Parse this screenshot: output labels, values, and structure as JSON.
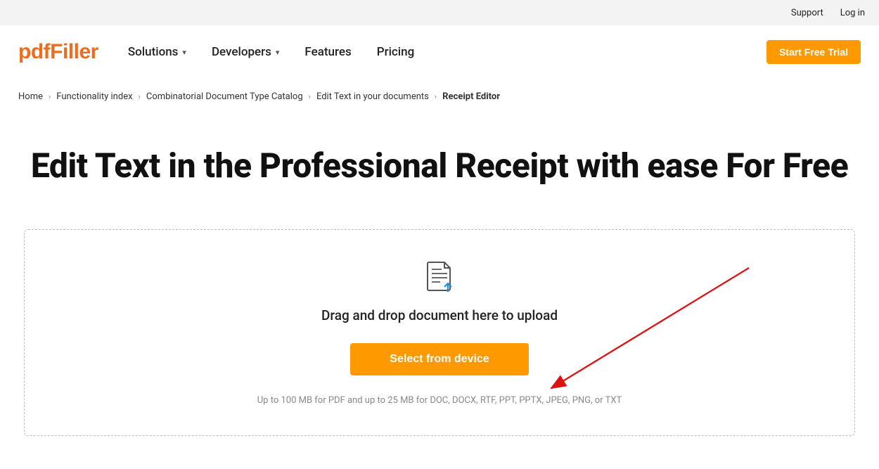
{
  "topbar": {
    "support": "Support",
    "login": "Log in"
  },
  "logo": {
    "pdf": "pdf",
    "filler": "Filler"
  },
  "nav": {
    "items": [
      {
        "label": "Solutions",
        "dropdown": true
      },
      {
        "label": "Developers",
        "dropdown": true
      },
      {
        "label": "Features",
        "dropdown": false
      },
      {
        "label": "Pricing",
        "dropdown": false
      }
    ],
    "cta": "Start Free Trial"
  },
  "breadcrumb": {
    "items": [
      "Home",
      "Functionality index",
      "Combinatorial Document Type Catalog",
      "Edit Text in your documents",
      "Receipt Editor"
    ]
  },
  "hero": {
    "title": "Edit Text in the Professional Receipt with ease For Free"
  },
  "upload": {
    "dragText": "Drag and drop document here to upload",
    "selectBtn": "Select from device",
    "note": "Up to 100 MB for PDF and up to 25 MB for DOC, DOCX, RTF, PPT, PPTX, JPEG, PNG, or TXT"
  }
}
